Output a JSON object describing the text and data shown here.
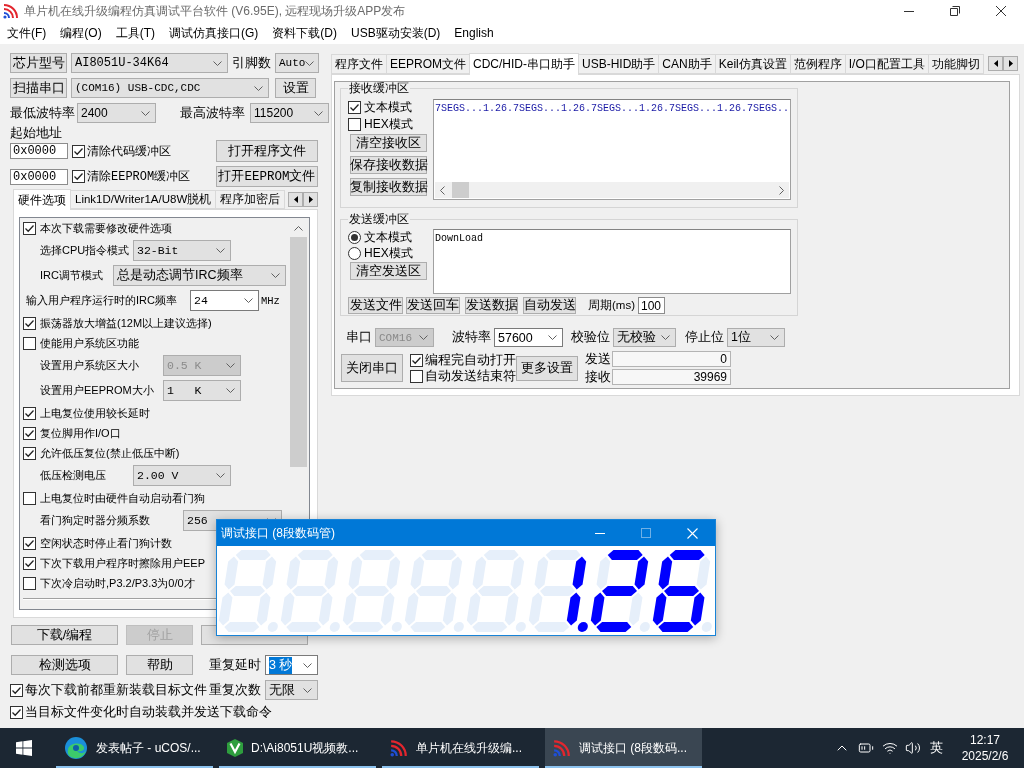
{
  "window": {
    "title": "单片机在线升级编程仿真调试平台软件 (V6.95E), 远程现场升级APP发布"
  },
  "menu": [
    "文件(F)",
    "编程(O)",
    "工具(T)",
    "调试仿真接口(G)",
    "资料下载(D)",
    "USB驱动安装(D)",
    "English"
  ],
  "left_panel": {
    "chip": {
      "button": "芯片型号",
      "value": "AI8051U-34K64",
      "pins_label": "引脚数",
      "pins": "Auto"
    },
    "port": {
      "button": "扫描串口",
      "value": "(COM16) USB-CDC,CDC",
      "settings_button": "设置"
    },
    "baud": {
      "min_label": "最低波特率",
      "min": "2400",
      "max_label": "最高波特率",
      "max": "115200"
    },
    "address_label": "起始地址",
    "address_rows": [
      {
        "address": "0x0000",
        "label": "清除代码缓冲区",
        "checked": true,
        "button": "打开程序文件"
      },
      {
        "address": "0x0000",
        "label": "清除EEPROM缓冲区",
        "checked": true,
        "button": "打开EEPROM文件"
      }
    ],
    "tabs": [
      {
        "label": "硬件选项",
        "selected": true
      },
      {
        "label": "Link1D/Writer1A/U8W脱机",
        "selected": false
      },
      {
        "label": "程序加密后",
        "selected": false
      }
    ],
    "options": [
      {
        "kind": "checkbox",
        "label": "本次下载需要修改硬件选项",
        "checked": true
      },
      {
        "kind": "select",
        "label": "选择CPU指令模式",
        "value": "32-Bit",
        "disabled": false
      },
      {
        "kind": "select",
        "label": "IRC调节模式",
        "value": "总是动态调节IRC频率",
        "disabled": false
      },
      {
        "kind": "input",
        "label": "输入用户程序运行时的IRC频率",
        "value": "24",
        "unit": "MHz",
        "disabled": false
      },
      {
        "kind": "checkbox",
        "label": "振荡器放大增益(12M以上建议选择)",
        "checked": true
      },
      {
        "kind": "checkbox",
        "label": "使能用户系统区功能",
        "checked": false
      },
      {
        "kind": "select",
        "label": "设置用户系统区大小",
        "value": "0.5 K",
        "disabled": true
      },
      {
        "kind": "select",
        "label": "设置用户EEPROM大小",
        "value": "1   K",
        "disabled": false
      },
      {
        "kind": "checkbox",
        "label": "上电复位使用较长延时",
        "checked": true
      },
      {
        "kind": "checkbox",
        "label": "复位脚用作I/O口",
        "checked": true
      },
      {
        "kind": "checkbox",
        "label": "允许低压复位(禁止低压中断)",
        "checked": true
      },
      {
        "kind": "select",
        "label": "低压检测电压",
        "value": "2.00 V",
        "disabled": false
      },
      {
        "kind": "checkbox",
        "label": "上电复位时由硬件自动启动看门狗",
        "checked": false
      },
      {
        "kind": "select",
        "label": "看门狗定时器分频系数",
        "value": "256",
        "disabled": false
      },
      {
        "kind": "checkbox",
        "label": "空闲状态时停止看门狗计数",
        "checked": true
      },
      {
        "kind": "checkbox",
        "label": "下次下载用户程序时擦除用户EEP",
        "checked": true
      },
      {
        "kind": "checkbox",
        "label": "下次冷启动时,P3.2/P3.3为0/0才",
        "checked": false
      }
    ],
    "actions": [
      {
        "label": "下载/编程",
        "disabled": false
      },
      {
        "label": "停止",
        "disabled": true
      },
      {
        "disabled": false
      }
    ],
    "tools": [
      "检测选项",
      "帮助"
    ],
    "repeat": [
      {
        "label": "重复延时",
        "value": "3 秒",
        "highlighted": true
      },
      {
        "label": "重复次数",
        "value": "无限",
        "highlighted": false
      }
    ],
    "bottom_checks": [
      {
        "label": "每次下载前都重新装载目标文件",
        "checked": true
      },
      {
        "label": "当目标文件变化时自动装载并发送下载命令",
        "checked": true
      }
    ]
  },
  "right_panel": {
    "tabs": [
      {
        "label": "程序文件",
        "selected": false
      },
      {
        "label": "EEPROM文件",
        "selected": false
      },
      {
        "label": "CDC/HID-串口助手",
        "selected": true
      },
      {
        "label": "USB-HID助手",
        "selected": false
      },
      {
        "label": "CAN助手",
        "selected": false
      },
      {
        "label": "Keil仿真设置",
        "selected": false
      },
      {
        "label": "范例程序",
        "selected": false
      },
      {
        "label": "I/O口配置工具",
        "selected": false
      },
      {
        "label": "功能脚切",
        "selected": false
      }
    ],
    "receive": {
      "title": "接收缓冲区",
      "modes": [
        {
          "label": "文本模式",
          "checked": true
        },
        {
          "label": "HEX模式",
          "checked": false
        }
      ],
      "buttons": [
        "清空接收区",
        "保存接收数据",
        "复制接收数据"
      ],
      "text": "7SEGS...1.26.7SEGS...1.26.7SEGS...1.26.7SEGS...1.26.7SEGS.."
    },
    "send": {
      "title": "发送缓冲区",
      "modes": [
        {
          "label": "文本模式",
          "selected": true
        },
        {
          "label": "HEX模式",
          "selected": false
        }
      ],
      "clear_button": "清空发送区",
      "text": "DownLoad",
      "buttons": [
        "发送文件",
        "发送回车",
        "发送数据",
        "自动发送"
      ],
      "period_label": "周期(ms)",
      "period": "100"
    },
    "port_settings": [
      {
        "label": "串口",
        "value": "COM16",
        "disabled": true
      },
      {
        "label": "波特率",
        "value": "57600",
        "disabled": false
      },
      {
        "label": "校验位",
        "value": "无校验",
        "disabled": false
      },
      {
        "label": "停止位",
        "value": "1位",
        "disabled": false
      }
    ],
    "close_port_button": "关闭串口",
    "port_options": [
      {
        "label": "编程完自动打开",
        "checked": true
      },
      {
        "label": "自动发送结束符",
        "checked": false
      }
    ],
    "more_button": "更多设置",
    "counters": [
      {
        "label": "发送",
        "value": "0"
      },
      {
        "label": "接收",
        "value": "39969"
      }
    ]
  },
  "dialog": {
    "title": "调试接口 (8段数码管)",
    "digits": [
      {
        "segments": [
          false,
          false,
          false,
          false,
          false,
          false,
          false
        ],
        "dp": false
      },
      {
        "segments": [
          false,
          false,
          false,
          false,
          false,
          false,
          false
        ],
        "dp": false
      },
      {
        "segments": [
          false,
          false,
          false,
          false,
          false,
          false,
          false
        ],
        "dp": false
      },
      {
        "segments": [
          false,
          false,
          false,
          false,
          false,
          false,
          false
        ],
        "dp": false
      },
      {
        "segments": [
          false,
          false,
          false,
          false,
          false,
          false,
          false
        ],
        "dp": false
      },
      {
        "segments": [
          false,
          true,
          true,
          false,
          false,
          false,
          false
        ],
        "dp": true
      },
      {
        "segments": [
          true,
          true,
          false,
          true,
          true,
          false,
          true
        ],
        "dp": false
      },
      {
        "segments": [
          true,
          false,
          true,
          true,
          true,
          true,
          true
        ],
        "dp": false
      }
    ]
  },
  "taskbar": {
    "apps": [
      {
        "kind": "browser",
        "label": "发表帖子 - uCOS/...",
        "selected": false
      },
      {
        "kind": "editor",
        "label": "D:\\Ai8051U视频教...",
        "selected": false
      },
      {
        "kind": "app",
        "label": "单片机在线升级编...",
        "selected": false
      },
      {
        "kind": "app",
        "label": "调试接口 (8段数码...",
        "selected": true
      }
    ],
    "ime": "英",
    "time": "12:17",
    "date": "2025/2/6"
  }
}
